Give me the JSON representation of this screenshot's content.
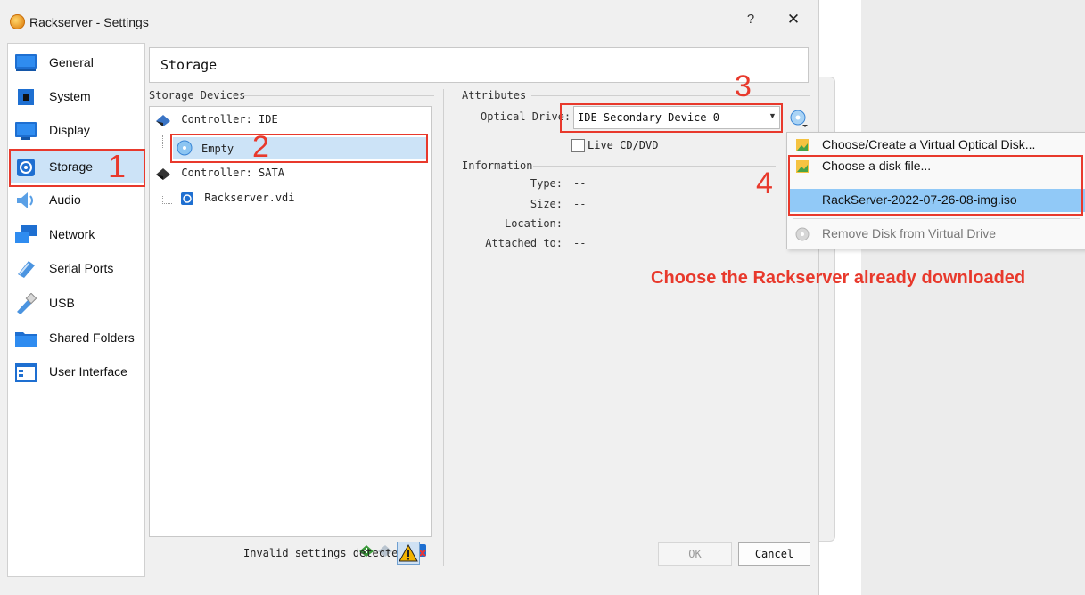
{
  "window": {
    "title": "Rackserver - Settings",
    "help": "?",
    "close": "✕"
  },
  "sidebar": {
    "items": [
      {
        "label": "General",
        "icon": "general-icon"
      },
      {
        "label": "System",
        "icon": "system-icon"
      },
      {
        "label": "Display",
        "icon": "display-icon"
      },
      {
        "label": "Storage",
        "icon": "storage-icon",
        "selected": true
      },
      {
        "label": "Audio",
        "icon": "audio-icon"
      },
      {
        "label": "Network",
        "icon": "network-icon"
      },
      {
        "label": "Serial Ports",
        "icon": "serial-ports-icon"
      },
      {
        "label": "USB",
        "icon": "usb-icon"
      },
      {
        "label": "Shared Folders",
        "icon": "shared-folders-icon"
      },
      {
        "label": "User Interface",
        "icon": "user-interface-icon"
      }
    ]
  },
  "page": {
    "title": "Storage"
  },
  "storage_devices": {
    "label": "Storage Devices",
    "tree": [
      {
        "label": "Controller: IDE",
        "type": "controller"
      },
      {
        "label": "Empty",
        "type": "optical",
        "selected": true
      },
      {
        "label": "Controller: SATA",
        "type": "controller"
      },
      {
        "label": "Rackserver.vdi",
        "type": "disk"
      }
    ]
  },
  "attributes": {
    "label": "Attributes",
    "optical_drive_label": "Optical Drive:",
    "optical_drive_value": "IDE Secondary Device 0",
    "live_cd_label": "Live CD/DVD",
    "live_cd_checked": false
  },
  "information": {
    "label": "Information",
    "rows": [
      {
        "key": "Type:",
        "value": "--"
      },
      {
        "key": "Size:",
        "value": "--"
      },
      {
        "key": "Location:",
        "value": "--"
      },
      {
        "key": "Attached to:",
        "value": "--"
      }
    ]
  },
  "footer": {
    "invalid_text": "Invalid settings detected",
    "ok": "OK",
    "cancel": "Cancel"
  },
  "menu": {
    "items": [
      {
        "label": "Choose/Create a Virtual Optical Disk...",
        "enabled": true
      },
      {
        "label": "Choose a disk file...",
        "enabled": true
      },
      {
        "label": "RackServer-2022-07-26-08-img.iso",
        "enabled": true,
        "highlighted": true
      },
      {
        "label": "Remove Disk from Virtual Drive",
        "enabled": false
      }
    ]
  },
  "annotations": {
    "step1": "1",
    "step2": "2",
    "step3": "3",
    "step4": "4",
    "instruction": "Choose the Rackserver already downloaded",
    "color": "#e8392c"
  }
}
